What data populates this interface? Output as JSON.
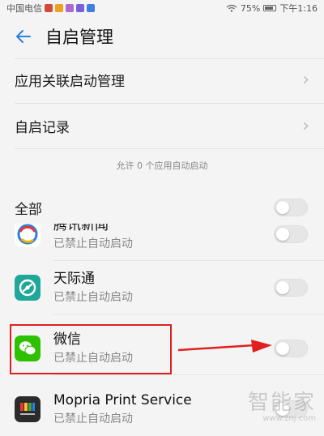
{
  "status_bar": {
    "carrier": "中国电信",
    "battery": "75%",
    "time": "下午1:16"
  },
  "header": {
    "title": "自启管理"
  },
  "menu": [
    {
      "label": "应用关联启动管理"
    },
    {
      "label": "自启记录"
    }
  ],
  "hint": "允许 0 个应用自动启动",
  "all_label": "全部",
  "apps": [
    {
      "name": "腾讯新闻",
      "status": "已禁止自动启动",
      "icon": "tencent-news-icon"
    },
    {
      "name": "天际通",
      "status": "已禁止自动启动",
      "icon": "tianjitong-icon"
    },
    {
      "name": "微信",
      "status": "已禁止自动启动",
      "icon": "wechat-icon"
    },
    {
      "name": "Mopria Print Service",
      "status": "已禁止自动启动",
      "icon": "mopria-icon"
    }
  ],
  "watermark": {
    "brand": "智能家",
    "url": "www.znj.com"
  },
  "colors": {
    "accent": "#2a7fe0",
    "highlight": "#e02020"
  }
}
